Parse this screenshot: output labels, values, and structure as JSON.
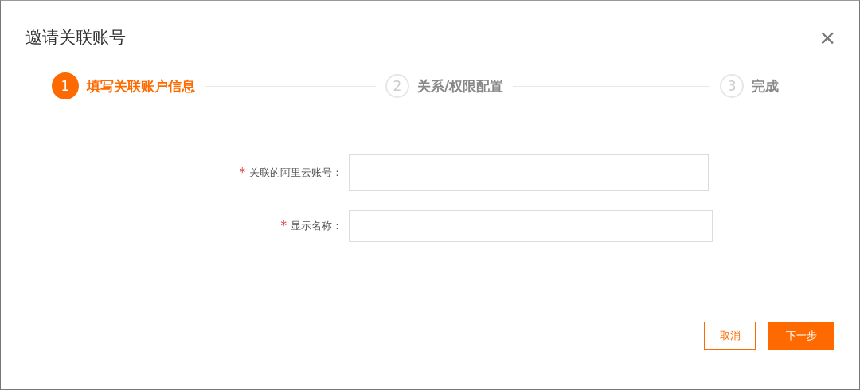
{
  "dialog": {
    "title": "邀请关联账号",
    "close": "×"
  },
  "steps": [
    {
      "number": "1",
      "label": "填写关联账户信息",
      "selected": true
    },
    {
      "number": "2",
      "label": "关系/权限配置",
      "selected": false
    },
    {
      "number": "3",
      "label": "完成",
      "selected": false
    }
  ],
  "fields": [
    {
      "label": "关联的阿里云账号：",
      "required_mark": "*"
    },
    {
      "label": "显示名称：",
      "required_mark": "*"
    }
  ],
  "buttons": [
    {
      "label": "取消",
      "kind": "secondary"
    },
    {
      "label": "下一步",
      "kind": "primary"
    }
  ]
}
